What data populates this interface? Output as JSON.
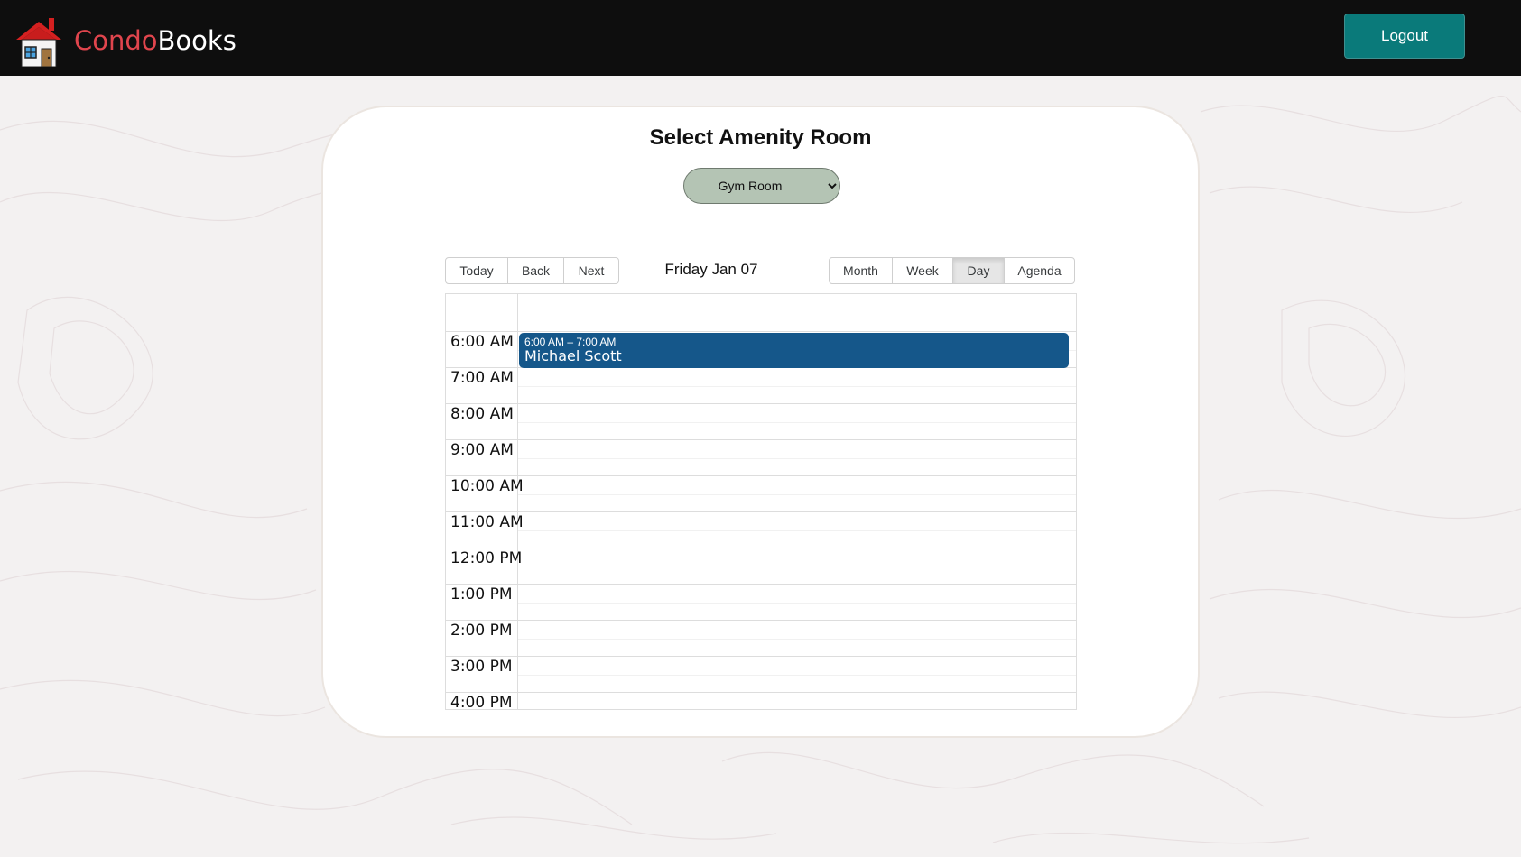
{
  "header": {
    "brand_part1": "Condo",
    "brand_part2": "Books",
    "logo_icon": "house-icon",
    "logout_label": "Logout"
  },
  "card": {
    "title": "Select Amenity Room",
    "room_select": {
      "value": "Gym Room",
      "options": [
        "Gym Room"
      ]
    }
  },
  "calendar": {
    "nav_buttons": [
      "Today",
      "Back",
      "Next"
    ],
    "date_label": "Friday Jan 07",
    "view_buttons": [
      "Month",
      "Week",
      "Day",
      "Agenda"
    ],
    "active_view": "Day",
    "time_slots": [
      "6:00 AM",
      "7:00 AM",
      "8:00 AM",
      "9:00 AM",
      "10:00 AM",
      "11:00 AM",
      "12:00 PM",
      "1:00 PM",
      "2:00 PM",
      "3:00 PM",
      "4:00 PM"
    ],
    "event": {
      "time": "6:00 AM – 7:00 AM",
      "title": "Michael Scott"
    }
  },
  "colors": {
    "header_bg": "#0e0e0e",
    "brand_accent": "#e0454d",
    "logout_bg": "#0a7a7a",
    "event_bg": "#15578a",
    "select_bg": "#b4c4b4"
  }
}
